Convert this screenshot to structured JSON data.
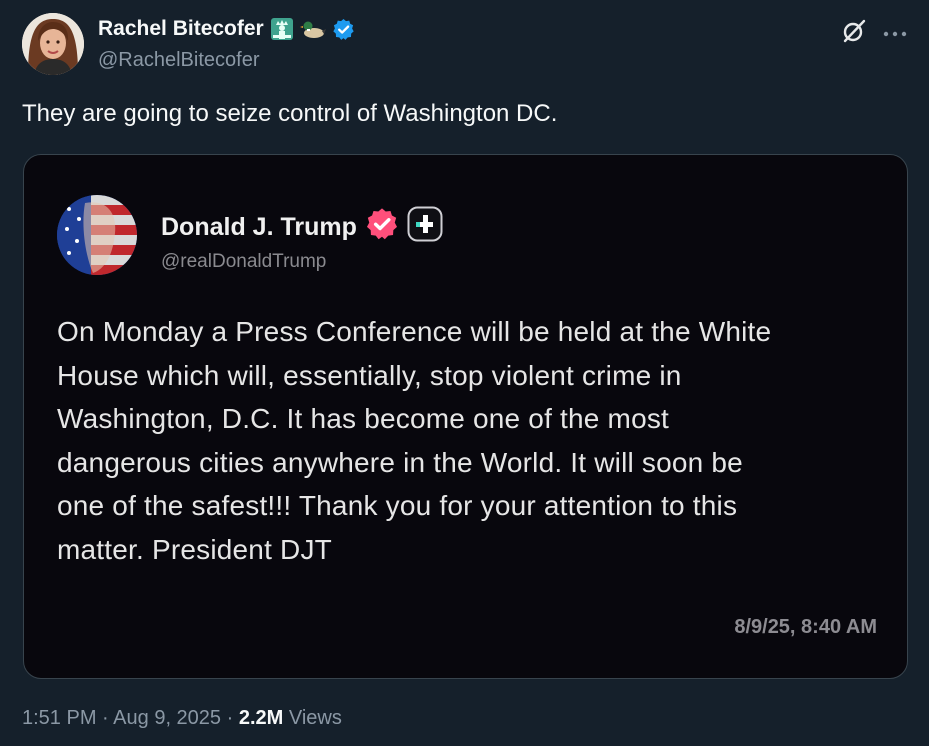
{
  "author": {
    "name": "Rachel Bitecofer",
    "handle": "@RachelBitecofer",
    "emojis": [
      "statue-of-liberty",
      "duck"
    ],
    "verified": true
  },
  "tweet": {
    "text": "They are going to seize control of Washington DC."
  },
  "embedded_post": {
    "name": "Donald J. Trump",
    "handle": "@realDonaldTrump",
    "body_lines": [
      "On Monday a Press Conference will be held at the White",
      "House which will, essentially, stop violent crime in",
      "Washington, D.C. It has become one of the most",
      "dangerous cities anywhere in the World. It will soon be",
      "one of the safest!!! Thank you for your attention to this",
      "matter. President DJT"
    ],
    "timestamp": "8/9/25, 8:40 AM"
  },
  "meta": {
    "time": "1:51 PM",
    "date": "Aug 9, 2025",
    "views_count": "2.2M",
    "views_label": "Views"
  },
  "colors": {
    "background": "#15202b",
    "verified_blue": "#1d9bf0",
    "truth_badge": "#ff4f7b"
  }
}
